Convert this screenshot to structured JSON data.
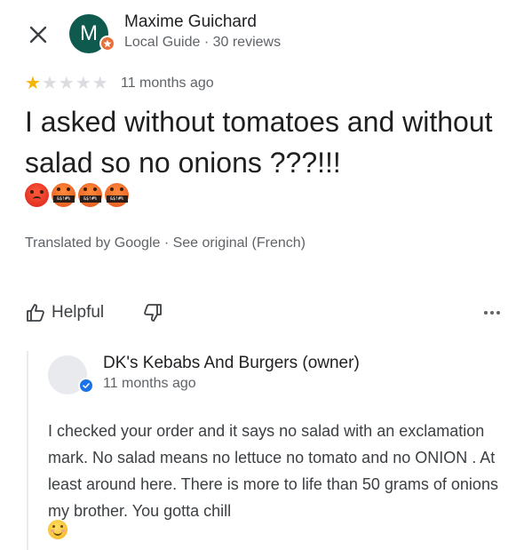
{
  "reviewer": {
    "name": "Maxime Guichard",
    "avatar_letter": "M",
    "meta": "Local Guide · 30 reviews"
  },
  "rating": {
    "value": 1,
    "max": 5
  },
  "review": {
    "time": "11 months ago",
    "text": "I asked without tomatoes and without salad so no onions ???!!!",
    "translated_note": "Translated by Google · See original (French)"
  },
  "actions": {
    "helpful_label": "Helpful"
  },
  "owner_reply": {
    "name": "DK's Kebabs And Burgers (owner)",
    "time": "11 months ago",
    "text": "I checked your order and it says no salad with an exclamation mark. No salad means no lettuce no tomato and no ONION . At least around here. There is more to life than 50 grams of onions my brother. You gotta chill"
  },
  "colors": {
    "star_filled": "#f4b400",
    "star_empty": "#dadce0",
    "avatar_bg": "#0f5a4f",
    "guide_badge": "#e8703a",
    "verified": "#1a73e8"
  }
}
